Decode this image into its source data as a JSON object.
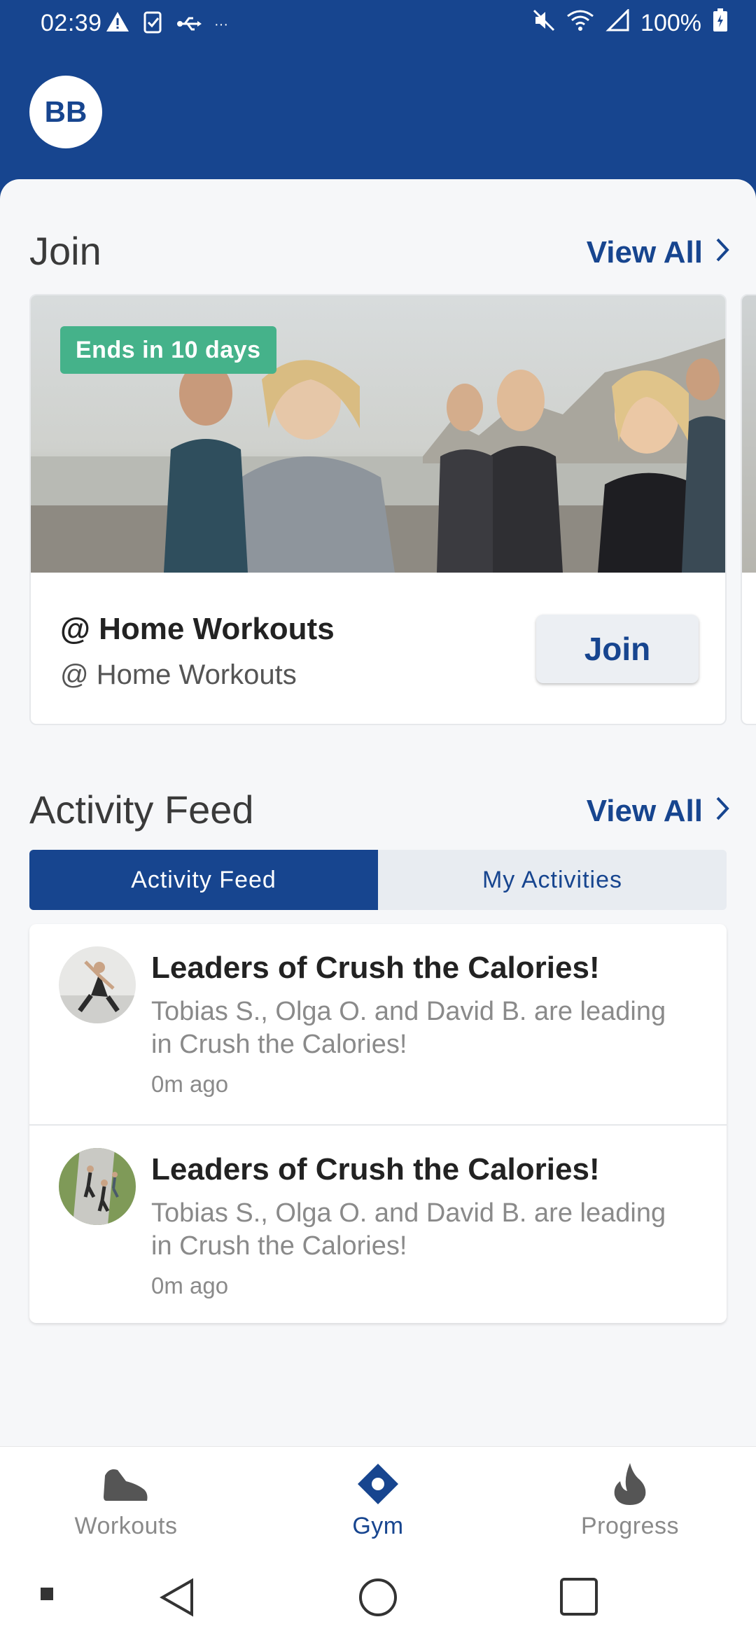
{
  "status_bar": {
    "time": "02:39",
    "battery": "100%",
    "left_icons": [
      "warning-icon",
      "clipboard-check-icon",
      "usb-icon",
      "more-dots-icon"
    ],
    "right_icons": [
      "mute-icon",
      "wifi-icon",
      "signal-icon",
      "battery-icon"
    ]
  },
  "header": {
    "avatar_initials": "BB"
  },
  "join_section": {
    "title": "Join",
    "view_all": "View All",
    "card": {
      "badge": "Ends in 10 days",
      "title": "@ Home Workouts",
      "subtitle": "@ Home Workouts",
      "button": "Join"
    }
  },
  "activity_section": {
    "title": "Activity Feed",
    "view_all": "View All",
    "tabs": [
      {
        "label": "Activity Feed",
        "active": true
      },
      {
        "label": "My Activities",
        "active": false
      }
    ],
    "items": [
      {
        "title": "Leaders of Crush the Calories!",
        "text": "Tobias S., Olga O. and David B. are leading in Crush the Calories!",
        "time": "0m ago"
      },
      {
        "title": "Leaders of Crush the Calories!",
        "text": "Tobias S., Olga O. and David B. are leading in Crush the Calories!",
        "time": "0m ago"
      }
    ]
  },
  "bottom_nav": [
    {
      "label": "Workouts",
      "icon": "shoe-icon",
      "active": false
    },
    {
      "label": "Gym",
      "icon": "gym-diamond-icon",
      "active": true
    },
    {
      "label": "Progress",
      "icon": "flame-icon",
      "active": false
    }
  ],
  "colors": {
    "primary": "#17458f",
    "badge": "#45b28a",
    "muted_text": "#8a8a8a"
  }
}
